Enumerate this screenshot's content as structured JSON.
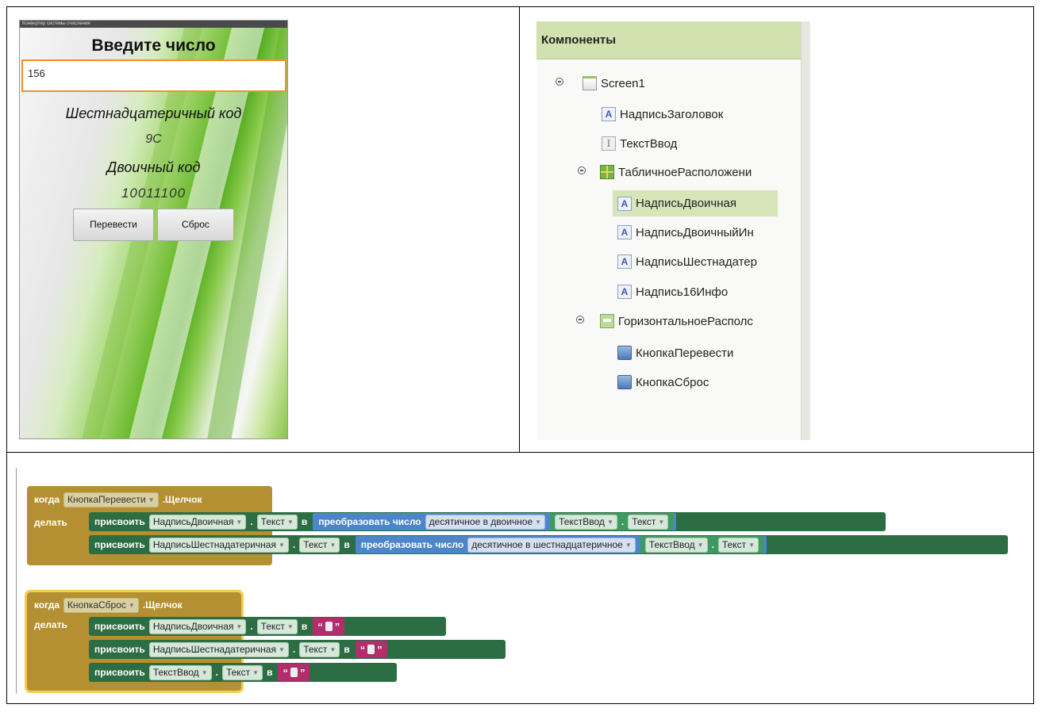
{
  "phone": {
    "status_title": "Конвертер системы счисления",
    "title": "Введите число",
    "input_value": "156",
    "hex_label": "Шестнадцатеричный  код",
    "hex_value": "9С",
    "bin_label": "Двоичный код",
    "bin_value": "10011100",
    "convert_button": "Перевести",
    "reset_button": "Сброс"
  },
  "components": {
    "header": "Компоненты",
    "items": [
      {
        "label": "Screen1",
        "icon": "screen-icon"
      },
      {
        "label": "НадписьЗаголовок",
        "icon": "label-icon"
      },
      {
        "label": "ТекстВвод",
        "icon": "textbox-icon"
      },
      {
        "label": "ТабличноеРасположени",
        "icon": "table-arrangement-icon"
      },
      {
        "label": "НадписьДвоичная",
        "icon": "label-icon"
      },
      {
        "label": "НадписьДвоичныйИн",
        "icon": "label-icon"
      },
      {
        "label": "НадписьШестнадатер",
        "icon": "label-icon"
      },
      {
        "label": "Надпись16Инфо",
        "icon": "label-icon"
      },
      {
        "label": "ГоризонтальноеРасполс",
        "icon": "horizontal-arrangement-icon"
      },
      {
        "label": "КнопкаПеревести",
        "icon": "button-icon"
      },
      {
        "label": "КнопкаСброс",
        "icon": "button-icon"
      }
    ]
  },
  "blocks": {
    "when": "когда",
    "do": "делать",
    "click": ".Щелчок",
    "set": "присвоить",
    "to": "в",
    "dot": ".",
    "convert_number": "преобразовать число",
    "dec_to_bin": "десятичное в двоичное",
    "dec_to_hex": "десятичное в шестнадцатеричное",
    "btn_convert": "КнопкаПеревести",
    "btn_reset": "КнопкаСброс",
    "lbl_bin": "НадписьДвоичная",
    "lbl_hex": "НадписьШестнадатеричная",
    "txt_input": "ТекстВвод",
    "prop_text": "Текст",
    "quote_open": "“",
    "quote_close": "”"
  },
  "colors": {
    "event": "#b49032",
    "setter": "#2d6d43",
    "math": "#4c86c8",
    "getter": "#3f9a62",
    "string": "#b12d6b",
    "focus": "#f4cc4f",
    "input_border": "#f0902a"
  }
}
